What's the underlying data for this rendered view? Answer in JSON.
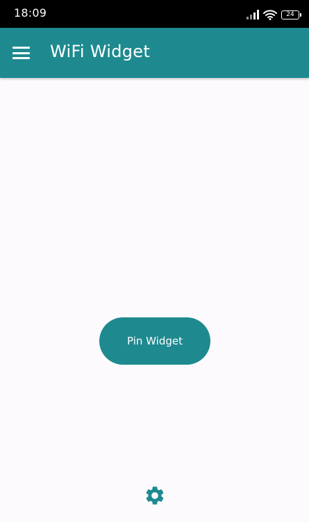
{
  "status_bar": {
    "time": "18:09",
    "battery_level": "24",
    "icons": [
      "signal-icon",
      "wifi-icon",
      "battery-icon"
    ]
  },
  "app_bar": {
    "title": "WiFi Widget",
    "menu_icon": "menu-icon"
  },
  "main": {
    "pin_button_label": "Pin Widget"
  },
  "footer": {
    "settings_icon": "gear-icon"
  },
  "colors": {
    "primary": "#1e8a8f",
    "background": "#fdfafd",
    "status_bar": "#000000"
  }
}
